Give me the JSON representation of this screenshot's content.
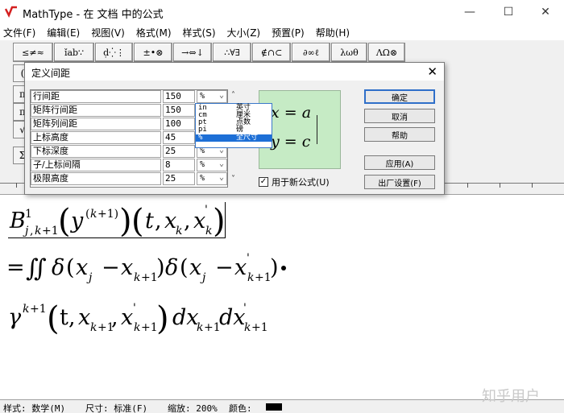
{
  "window": {
    "title": "MathType - 在 文档 中的公式"
  },
  "menu": [
    "文件(F)",
    "编辑(E)",
    "视图(V)",
    "格式(M)",
    "样式(S)",
    "大小(Z)",
    "预置(P)",
    "帮助(H)"
  ],
  "palette_row1": [
    "≤≠≈",
    "ǐab∵",
    "±•⊗",
    "→⇔↓",
    "∴∀∃",
    "∉∩⊂",
    "∂∞ℓ",
    "λωθ",
    "ΛΩ⊗"
  ],
  "palette_side": [
    "(",
    "π",
    "π",
    "√",
    "Σ"
  ],
  "dialog": {
    "title": "定义间距",
    "rows": [
      {
        "label": "行间距",
        "value": "150",
        "unit": "%"
      },
      {
        "label": "矩阵行间距",
        "value": "150",
        "unit": "%"
      },
      {
        "label": "矩阵列间距",
        "value": "100",
        "unit": "%"
      },
      {
        "label": "上标高度",
        "value": "45",
        "unit": "%"
      },
      {
        "label": "下标深度",
        "value": "25",
        "unit": "%"
      },
      {
        "label": "子/上标间隔",
        "value": "8",
        "unit": "%"
      },
      {
        "label": "极限高度",
        "value": "25",
        "unit": "%"
      }
    ],
    "unit_options": [
      {
        "code": "in",
        "name": "英寸"
      },
      {
        "code": "cm",
        "name": "厘米"
      },
      {
        "code": "pt",
        "name": "点数"
      },
      {
        "code": "pi",
        "name": "磅"
      },
      {
        "code": "%",
        "name": "全尺寸"
      }
    ],
    "preview": {
      "eq1": "x = a",
      "eq2": "y = c"
    },
    "checkbox_label": "用于新公式(U)",
    "buttons": {
      "ok": "确定",
      "cancel": "取消",
      "help": "帮助",
      "apply": "应用(A)",
      "factory": "出厂设置(F)"
    }
  },
  "editor": {
    "line2": "= ∬ δ(x",
    "line3": "γ"
  },
  "status": {
    "style": "样式: 数学(M)",
    "size": "尺寸: 标准(F)",
    "zoom": "缩放: 200%",
    "color": "颜色:"
  },
  "watermark": "知乎用户"
}
